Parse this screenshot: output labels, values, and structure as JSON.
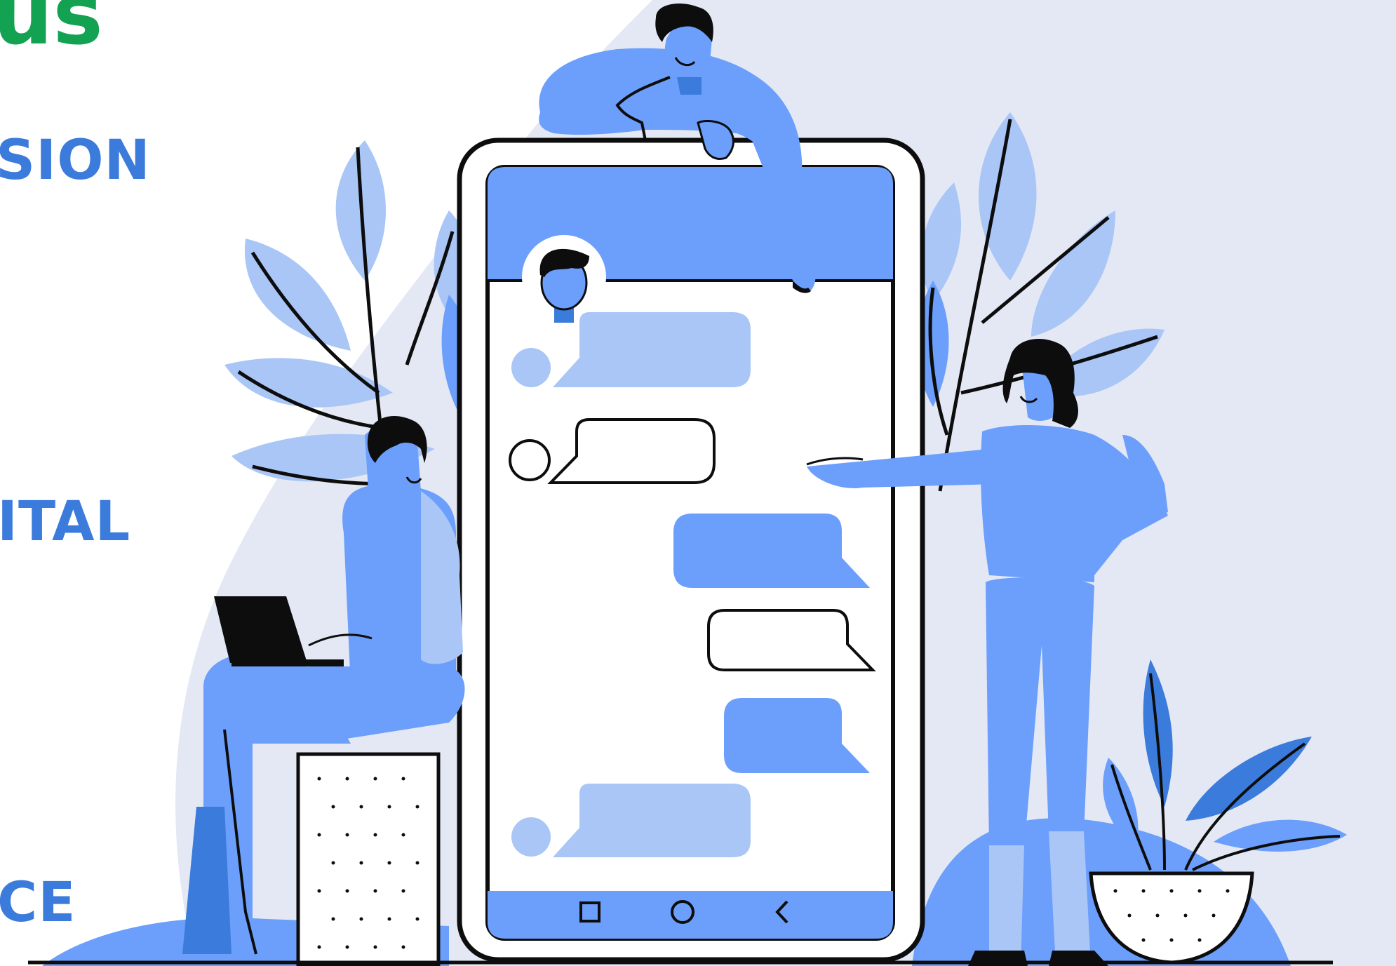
{
  "heading": {
    "text": "us",
    "color": "#12a251"
  },
  "side_labels": [
    {
      "text": "SION"
    },
    {
      "text": "ITAL"
    },
    {
      "text": "CE"
    }
  ],
  "colors": {
    "background": "#ffffff",
    "backdrop": "#e4e8f4",
    "primary_blue": "#6b9ffb",
    "light_blue": "#a9c6f6",
    "dark_blue": "#3b7bdb",
    "outline": "#0d0d0d",
    "label": "#3b7bdb"
  },
  "phone": {
    "nav_icons": [
      "square-icon",
      "circle-icon",
      "back-chevron-icon"
    ]
  },
  "illustration": {
    "subject": "people-chatting-around-smartphone"
  }
}
